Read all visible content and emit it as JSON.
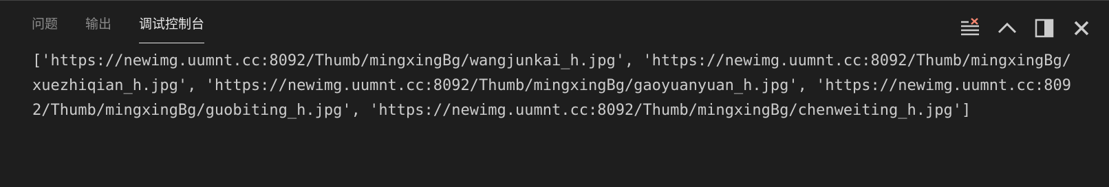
{
  "panel": {
    "tabs": [
      {
        "label": "问题",
        "active": false
      },
      {
        "label": "输出",
        "active": false
      },
      {
        "label": "调试控制台",
        "active": true
      }
    ],
    "actions": [
      {
        "icon": "clear-console-icon"
      },
      {
        "icon": "chevron-up-icon"
      },
      {
        "icon": "maximize-panel-icon"
      },
      {
        "icon": "close-icon"
      }
    ]
  },
  "console": {
    "output": "['https://newimg.uumnt.cc:8092/Thumb/mingxingBg/wangjunkai_h.jpg', 'https://newimg.uumnt.cc:8092/Thumb/mingxingBg/xuezhiqian_h.jpg', 'https://newimg.uumnt.cc:8092/Thumb/mingxingBg/gaoyuanyuan_h.jpg', 'https://newimg.uumnt.cc:8092/Thumb/mingxingBg/guobiting_h.jpg', 'https://newimg.uumnt.cc:8092/Thumb/mingxingBg/chenweiting_h.jpg']"
  },
  "colors": {
    "background": "#1e1e1e",
    "tab_inactive": "#8b8b8b",
    "tab_active": "#e7e7e7",
    "text": "#cccccc",
    "clear_icon_accent": "#f48771"
  }
}
